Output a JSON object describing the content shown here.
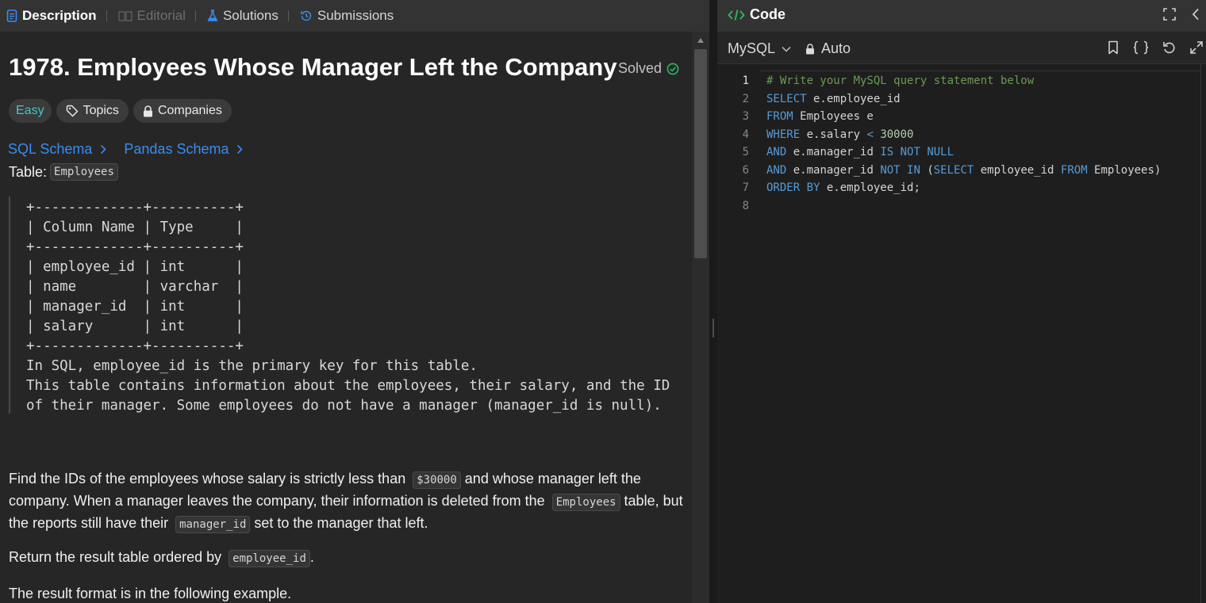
{
  "left_tabs": {
    "description": "Description",
    "editorial": "Editorial",
    "solutions": "Solutions",
    "submissions": "Submissions"
  },
  "problem": {
    "title": "1978. Employees Whose Manager Left the Company",
    "status": "Solved",
    "difficulty": "Easy",
    "topics_label": "Topics",
    "companies_label": "Companies",
    "sql_schema_label": "SQL Schema",
    "pandas_schema_label": "Pandas Schema",
    "table_prefix": "Table:",
    "table_name": "Employees",
    "schema_block": "+-------------+----------+\n| Column Name | Type     |\n+-------------+----------+\n| employee_id | int      |\n| name        | varchar  |\n| manager_id  | int      |\n| salary      | int      |\n+-------------+----------+\nIn SQL, employee_id is the primary key for this table.\nThis table contains information about the employees, their salary, and the ID\nof their manager. Some employees do not have a manager (manager_id is null).",
    "para1_a": "Find the IDs of the employees whose salary is strictly less than ",
    "para1_code1": "$30000",
    "para1_b": " and whose manager left the company. When a manager leaves the company, their information is deleted from the ",
    "para1_code2": "Employees",
    "para1_c": " table, but the reports still have their ",
    "para1_code3": "manager_id",
    "para1_d": " set to the manager that left.",
    "para2_a": "Return the result table ordered by ",
    "para2_code": "employee_id",
    "para2_b": ".",
    "para3": "The result format is in the following example."
  },
  "code_panel": {
    "title": "Code",
    "language": "MySQL",
    "mode": "Auto",
    "line_numbers": [
      "1",
      "2",
      "3",
      "4",
      "5",
      "6",
      "7",
      "8"
    ],
    "lines": [
      [
        {
          "t": "comment",
          "v": "# Write your MySQL query statement below"
        }
      ],
      [
        {
          "t": "kw",
          "v": "SELECT"
        },
        {
          "t": "plain",
          "v": " e.employee_id"
        }
      ],
      [
        {
          "t": "kw",
          "v": "FROM"
        },
        {
          "t": "plain",
          "v": " Employees e"
        }
      ],
      [
        {
          "t": "kw",
          "v": "WHERE"
        },
        {
          "t": "plain",
          "v": " e.salary "
        },
        {
          "t": "op",
          "v": "<"
        },
        {
          "t": "plain",
          "v": " "
        },
        {
          "t": "num",
          "v": "30000"
        }
      ],
      [
        {
          "t": "kw",
          "v": "AND"
        },
        {
          "t": "plain",
          "v": " e.manager_id "
        },
        {
          "t": "kw",
          "v": "IS NOT NULL"
        }
      ],
      [
        {
          "t": "kw",
          "v": "AND"
        },
        {
          "t": "plain",
          "v": " e.manager_id "
        },
        {
          "t": "kw",
          "v": "NOT IN"
        },
        {
          "t": "plain",
          "v": " ("
        },
        {
          "t": "kw",
          "v": "SELECT"
        },
        {
          "t": "plain",
          "v": " employee_id "
        },
        {
          "t": "kw",
          "v": "FROM"
        },
        {
          "t": "plain",
          "v": " Employees)"
        }
      ],
      [
        {
          "t": "kw",
          "v": "ORDER BY"
        },
        {
          "t": "plain",
          "v": " e.employee_id;"
        }
      ],
      []
    ]
  },
  "colors": {
    "accent_blue": "#3a8bf0",
    "easy_teal": "#46c6c2",
    "solved_green": "#2cbb5d"
  }
}
